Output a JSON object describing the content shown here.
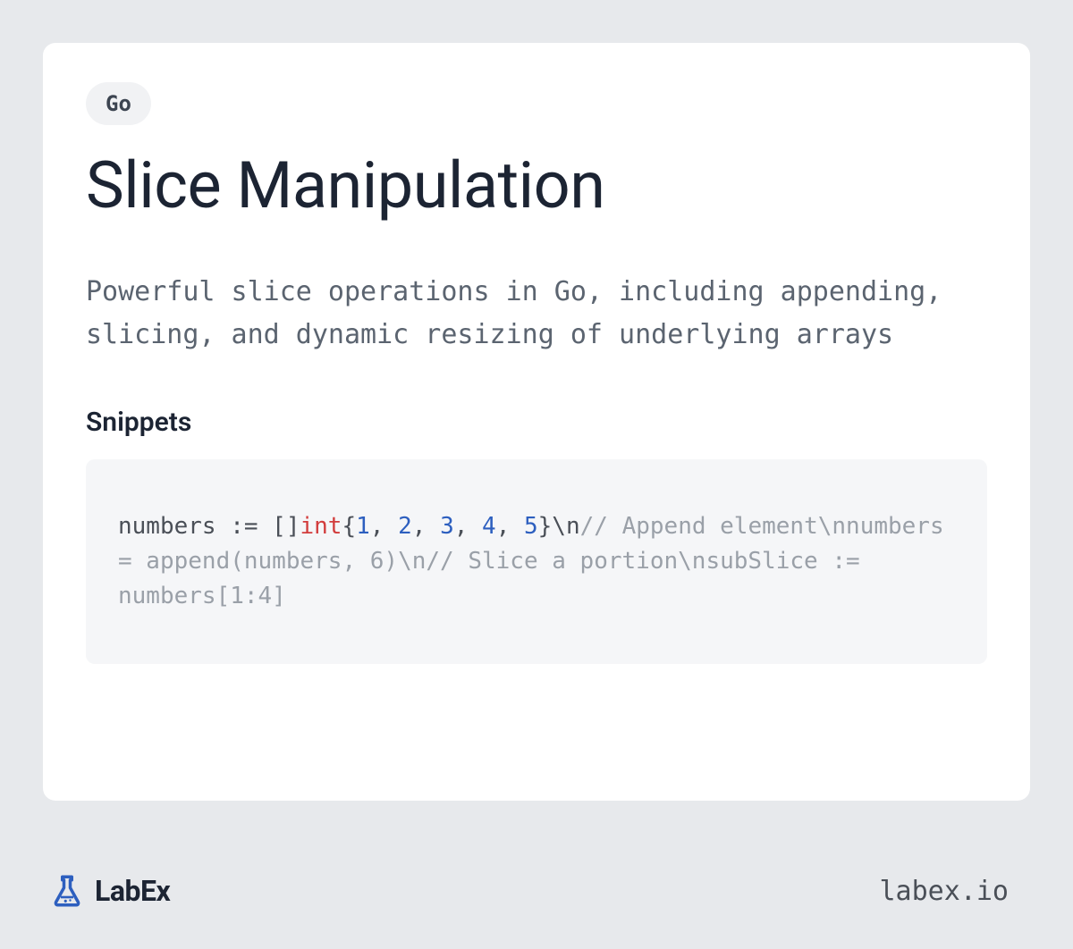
{
  "tag": "Go",
  "title": "Slice Manipulation",
  "description": "Powerful slice operations in Go, including appending, slicing, and dynamic resizing of underlying arrays",
  "snippets_heading": "Snippets",
  "code_tokens": [
    {
      "text": "numbers := []",
      "class": "tok-plain"
    },
    {
      "text": "int",
      "class": "tok-keyword"
    },
    {
      "text": "{",
      "class": "tok-punct"
    },
    {
      "text": "1",
      "class": "tok-number"
    },
    {
      "text": ", ",
      "class": "tok-punct"
    },
    {
      "text": "2",
      "class": "tok-number"
    },
    {
      "text": ", ",
      "class": "tok-punct"
    },
    {
      "text": "3",
      "class": "tok-number"
    },
    {
      "text": ", ",
      "class": "tok-punct"
    },
    {
      "text": "4",
      "class": "tok-number"
    },
    {
      "text": ", ",
      "class": "tok-punct"
    },
    {
      "text": "5",
      "class": "tok-number"
    },
    {
      "text": "}\\n",
      "class": "tok-punct"
    },
    {
      "text": "// Append element\\nnumbers = append(numbers, 6)\\n// Slice a portion\\nsubSlice := numbers[1:4]",
      "class": "tok-comment"
    }
  ],
  "brand": {
    "name": "LabEx",
    "icon_color": "#2d5fbf"
  },
  "site_url": "labex.io"
}
